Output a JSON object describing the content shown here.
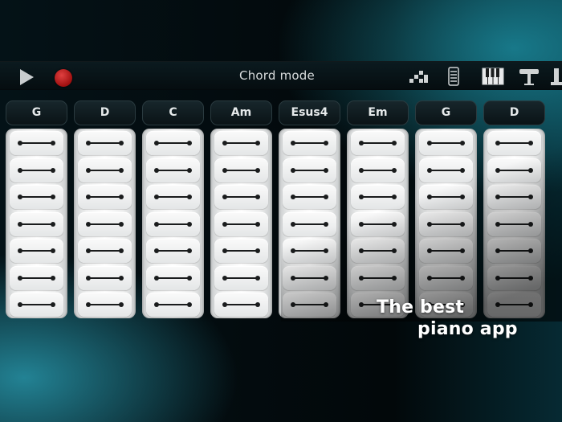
{
  "toolbar": {
    "title": "Chord mode",
    "play_icon": "play-icon",
    "record_icon": "record-icon",
    "tools": [
      "arpeggio-icon",
      "strip-icon",
      "piano-keys-icon",
      "stool-icon",
      "pedal-icon"
    ]
  },
  "chords": [
    {
      "label": "G"
    },
    {
      "label": "D"
    },
    {
      "label": "C"
    },
    {
      "label": "Am"
    },
    {
      "label": "Esus4"
    },
    {
      "label": "Em"
    },
    {
      "label": "G"
    },
    {
      "label": "D"
    }
  ],
  "strip_cells_per_chord": 7,
  "tagline": {
    "line1": "The best",
    "line2": "piano app"
  },
  "colors": {
    "record": "#c41818",
    "accent_teal": "#1e96aa",
    "strip": "#f2f3f3"
  }
}
